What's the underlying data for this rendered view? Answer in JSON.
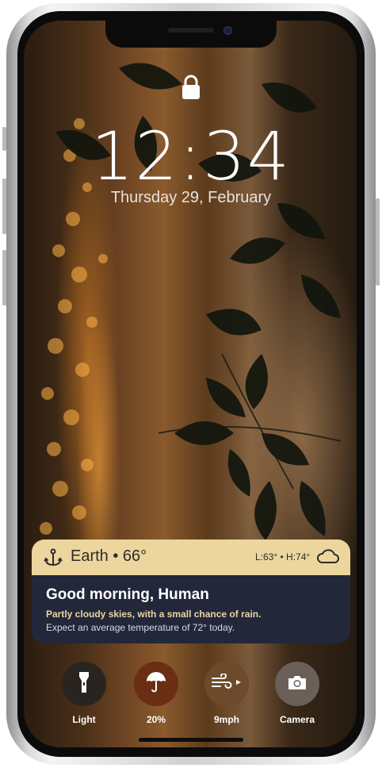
{
  "lock_screen": {
    "time": "12:34",
    "date": "Thursday 29, February"
  },
  "weather_widget": {
    "location": "Earth • 66°",
    "low_high": "L:63° • H:74°",
    "location_icon": "anchor-icon",
    "condition_icon": "cloud-icon",
    "greeting": "Good morning, Human",
    "condition": "Partly cloudy skies, with a small chance of rain.",
    "expectation": "Expect an average temperature of 72° today.",
    "colors": {
      "header": "#ecd69e",
      "body": "#22273a"
    }
  },
  "quick_controls": [
    {
      "label": "Light",
      "icon": "flashlight-icon",
      "color": "#2a2420"
    },
    {
      "label": "20%",
      "icon": "umbrella-icon",
      "color": "#6a2e14"
    },
    {
      "label": "9mph",
      "icon": "wind-icon",
      "color": "#6e4a2c"
    },
    {
      "label": "Camera",
      "icon": "camera-icon",
      "color": "#6a6058"
    }
  ]
}
